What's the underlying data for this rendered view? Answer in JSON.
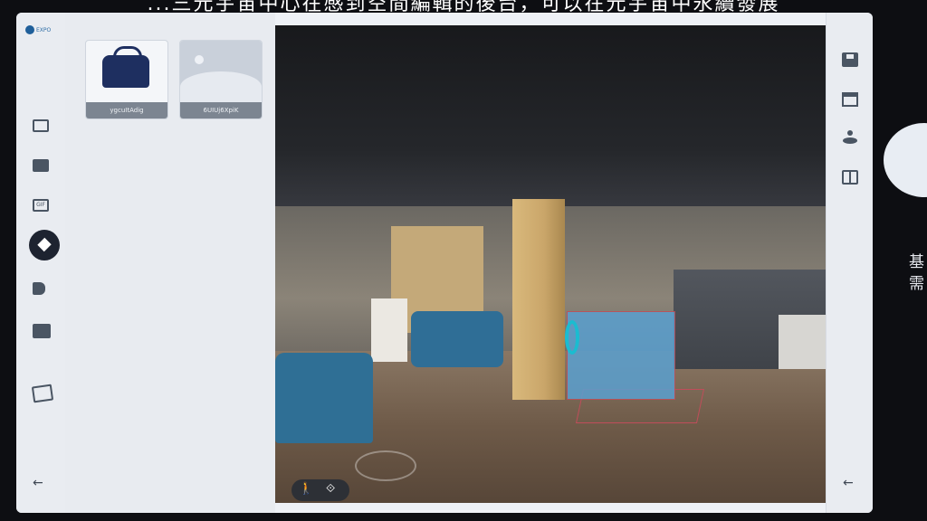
{
  "caption": "...三元宇宙中心在感到空間編輯的後台，可以在元宇宙中永續發展",
  "side_text": "基需",
  "logo": {
    "text": "EXPO"
  },
  "left_rail": {
    "items": [
      {
        "icon": "image-icon"
      },
      {
        "icon": "video-icon"
      },
      {
        "icon": "gif-icon",
        "label": "GIF"
      },
      {
        "icon": "3d-object-icon",
        "active": true
      },
      {
        "icon": "tag-icon"
      },
      {
        "icon": "folder-icon"
      },
      {
        "icon": "gallery-icon"
      }
    ],
    "back_icon": "←"
  },
  "library": {
    "assets": [
      {
        "label": "ygcuItAdig",
        "kind": "bag"
      },
      {
        "label": "6UIUj6XpiK",
        "kind": "placeholder"
      }
    ]
  },
  "viewport": {
    "controls": {
      "walk_icon": "🚶",
      "object_icon": "⟐"
    }
  },
  "right_rail": {
    "items": [
      {
        "icon": "save-icon"
      },
      {
        "icon": "window-icon"
      },
      {
        "icon": "person-pin-icon"
      },
      {
        "icon": "book-icon"
      }
    ],
    "back_icon": "←"
  },
  "colors": {
    "rail": "#e9ecf1",
    "active": "#1d2330",
    "accent": "#2e6ea6"
  }
}
